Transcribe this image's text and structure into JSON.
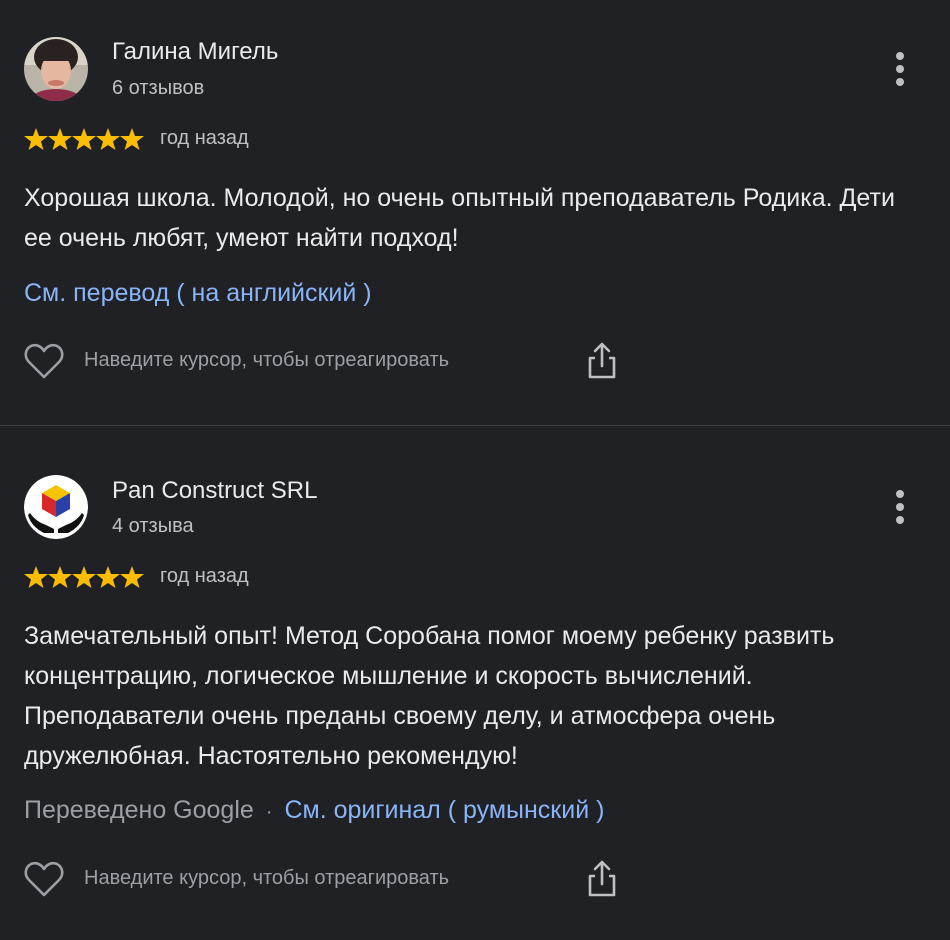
{
  "reviews": [
    {
      "author": "Галина Мигель",
      "review_count": "6 отзывов",
      "rating": 5,
      "date": "год назад",
      "text": "Хорошая школа. Молодой, но очень опытный преподаватель Родика. Дети ее очень любят, умеют найти подход!",
      "translate_link": "См. перевод ( на английский )",
      "hover_text": "Наведите курсор, чтобы отреагировать",
      "avatar_icon": "person-photo-avatar"
    },
    {
      "author": "Pan Construct SRL",
      "review_count": "4 отзыва",
      "rating": 5,
      "date": "год назад",
      "text": "Замечательный опыт! Метод Соробана помог моему ребенку развить концентрацию, логическое мышление и скорость вычислений. Преподаватели очень преданы своему делу, и атмосфера очень дружелюбная. Настоятельно рекомендую!",
      "translated_label": "Переведено Google",
      "separator": "·",
      "original_link": "См. оригинал ( румынский )",
      "hover_text": "Наведите курсор, чтобы отреагировать",
      "avatar_icon": "cube-hands-logo"
    }
  ],
  "colors": {
    "background": "#202124",
    "text": "#e8eaed",
    "secondary": "#bdc1c6",
    "link": "#8ab4f8",
    "star": "#fbbc04",
    "divider": "#3c4043"
  }
}
